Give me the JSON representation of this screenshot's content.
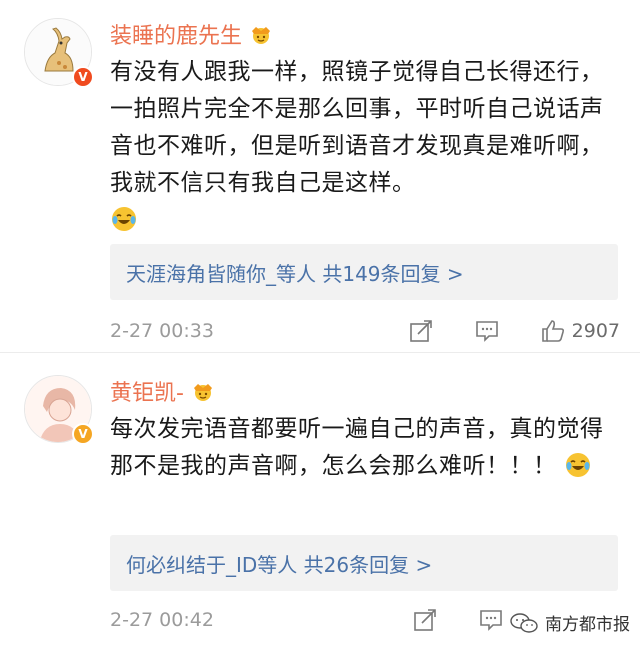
{
  "comments": [
    {
      "username": "装睡的鹿先生",
      "text": "有没有人跟我一样，照镜子觉得自己长得还行，一拍照片完全不是那么回事，平时听自己说话声音也不难听，但是听到语音才发现真是难听啊，我就不信只有我自己是这样。",
      "reply_summary": "天涯海角皆随你_等人  共149条回复 >",
      "timestamp": "2-27 00:33",
      "likes": "2907",
      "badge_icon": "v-badge-red"
    },
    {
      "username": "黄钜凯-",
      "text": "每次发完语音都要听一遍自己的声音，真的觉得那不是我的声音啊，怎么会那么难听！！！",
      "reply_summary": "何必纠结于_ID等人  共26条回复 >",
      "timestamp": "2-27 00:42",
      "likes": "",
      "badge_icon": "v-badge-yellow"
    }
  ],
  "watermark": "南方都市报",
  "colors": {
    "username": "#eb7350",
    "reply_link": "#4a72a8",
    "meta": "#9b9b9b"
  }
}
